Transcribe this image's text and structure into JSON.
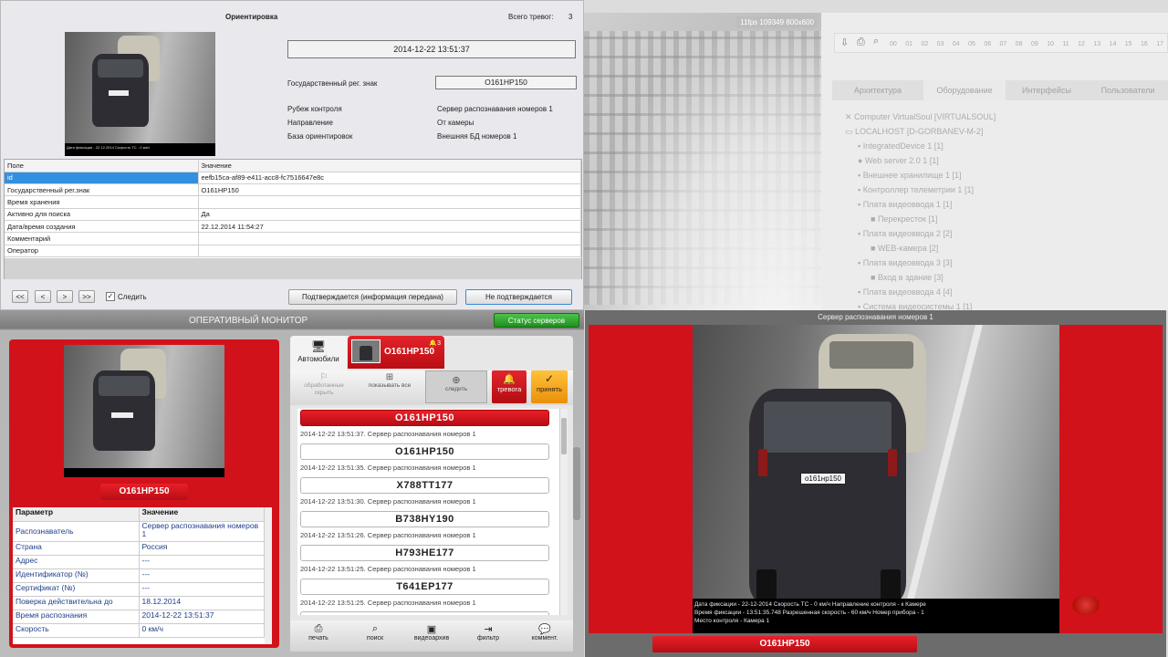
{
  "orientation": {
    "title": "Ориентировка",
    "alarm_count_label": "Всего тревог:",
    "alarm_count": "3",
    "datetime": "2014-12-22 13:51:37",
    "fields": [
      {
        "label": "Государственный рег. знак",
        "value": "O161HP150"
      },
      {
        "label": "Рубеж контроля",
        "value": "Сервер распознавания номеров 1"
      },
      {
        "label": "Направление",
        "value": "От камеры"
      },
      {
        "label": "База ориентировок",
        "value": "Внешняя БД номеров 1"
      }
    ],
    "photo_caption": "Дата фиксации - 22.12.2014 Скорость ТС - 0 км/ч",
    "table": {
      "headers": [
        "Поле",
        "Значение"
      ],
      "rows": [
        [
          "id",
          "eefb15ca-af89-e411-acc8-fc7516647e8c"
        ],
        [
          "Государственный рег.знак",
          "O161HP150"
        ],
        [
          "Время хранения",
          ""
        ],
        [
          "Активно для поиска",
          "Да"
        ],
        [
          "Дата/время создания",
          "22.12.2014 11:54:27"
        ],
        [
          "Комментарий",
          ""
        ],
        [
          "Оператор",
          ""
        ]
      ]
    },
    "nav": {
      "first": "<<",
      "prev": "<",
      "next": ">",
      "last": ">>",
      "follow_label": "Следить",
      "follow_checked": true
    },
    "confirm_label": "Подтверждается (информация передана)",
    "reject_label": "Не подтверждается"
  },
  "operative": {
    "title": "ОПЕРАТИВНЫЙ МОНИТОР",
    "server_status": "Статус серверов",
    "plate": "O161HP150",
    "params": {
      "headers": [
        "Параметр",
        "Значение"
      ],
      "rows": [
        [
          "Распознаватель",
          "Сервер распознавания номеров 1"
        ],
        [
          "Страна",
          "Россия"
        ],
        [
          "Адрес",
          "---"
        ],
        [
          "Идентификатор (№)",
          "---"
        ],
        [
          "Сертификат (№)",
          "---"
        ],
        [
          "Поверка действительна до",
          "18.12.2014"
        ],
        [
          "Время распознания",
          "2014-12-22 13:51:37"
        ],
        [
          "Скорость",
          "0 км/ч"
        ]
      ]
    },
    "tabs": {
      "cars_label": "Автомобили",
      "alert_plate": "O161HP150",
      "alert_count": "3"
    },
    "toolbar": {
      "processed_hide": "обработанные скрыть",
      "show_all": "показывать все",
      "follow": "следить",
      "alarm": "тревога",
      "accept": "принять"
    },
    "list": [
      {
        "plate": "O161HP150",
        "time": "2014-12-22 13:51:37. Сервер распознавания номеров 1",
        "active": true
      },
      {
        "plate": "O161HP150",
        "time": "2014-12-22 13:51:35. Сервер распознавания номеров 1",
        "active": false
      },
      {
        "plate": "X788TT177",
        "time": "2014-12-22 13:51:30. Сервер распознавания номеров 1",
        "active": false
      },
      {
        "plate": "B738HY190",
        "time": "2014-12-22 13:51:26. Сервер распознавания номеров 1",
        "active": false
      },
      {
        "plate": "H793HE177",
        "time": "2014-12-22 13:51:25. Сервер распознавания номеров 1",
        "active": false
      },
      {
        "plate": "T641EP177",
        "time": "2014-12-22 13:51:25. Сервер распознавания номеров 1",
        "active": false
      }
    ],
    "bottom": [
      "печать",
      "поиск",
      "видеоархив",
      "фильтр",
      "коммент."
    ]
  },
  "background": {
    "camera_badge": "11fps 109349 800x600",
    "timeline_ticks": [
      "00",
      "01",
      "02",
      "03",
      "04",
      "05",
      "06",
      "07",
      "08",
      "09",
      "10",
      "11",
      "12",
      "13",
      "14",
      "15",
      "16",
      "17"
    ],
    "tabs": [
      "Архитектура",
      "Оборудование",
      "Интерфейсы",
      "Пользователи"
    ],
    "tree": [
      "Computer VirtualSoul [VIRTUALSOUL]",
      "LOCALHOST [D-GORBANEV-M-2]",
      "IntegratedDevice 1 [1]",
      "Web server 2.0 1 [1]",
      "Внешнее хранилище 1 [1]",
      "Контроллер телеметрии 1 [1]",
      "Плата видеоввода 1 [1]",
      "Перекресток [1]",
      "Плата видеоввода 2 [2]",
      "WEB-камера [2]",
      "Плата видеоввода 3 [3]",
      "Вход в здание [3]",
      "Плата видеоввода 4 [4]",
      "Система видеосистемы 1 [1]"
    ]
  },
  "recognizer": {
    "title": "Сервер распознавания номеров 1",
    "caption_line1": "Дата фиксации - 22-12-2014  Скорость ТС - 0 км/ч  Направление контроля - к Камере",
    "caption_line2": "Время фиксации - 13:51:35.748     Разрешенная скорость - 60 км/ч     Номер прибора - 1",
    "caption_line3": "Место контроля - Камера 1",
    "plate": "O161HP150",
    "car_plate_text": "о161нр150"
  },
  "colors": {
    "red": "#d2121b",
    "dark_red": "#b00c12",
    "green": "#2aa02a",
    "orange": "#f4a215"
  }
}
